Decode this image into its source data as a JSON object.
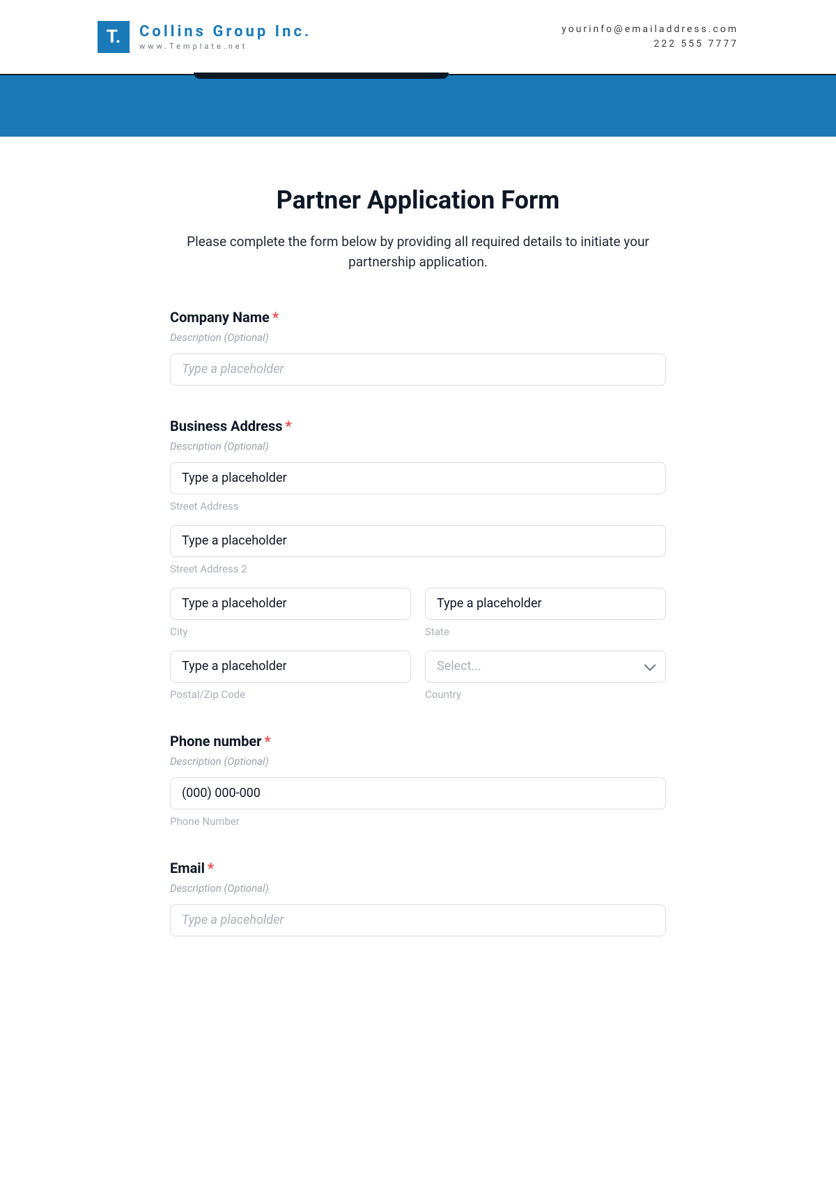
{
  "header": {
    "logo_text": "T.",
    "brand_name": "Collins Group Inc.",
    "brand_site": "www.Template.net",
    "contact_email": "yourinfo@emailaddress.com",
    "contact_phone": "222 555 7777"
  },
  "form": {
    "title": "Partner Application Form",
    "intro": "Please complete the form below by providing all required details to initiate your partnership application.",
    "description_label": "Description (Optional)",
    "generic_placeholder": "Type a placeholder",
    "required_marker": "*",
    "fields": {
      "company_name": {
        "label": "Company Name"
      },
      "business_address": {
        "label": "Business Address",
        "street": {
          "sublabel": "Street Address",
          "value": "Type a placeholder"
        },
        "street2": {
          "sublabel": "Street Address 2",
          "value": "Type a placeholder"
        },
        "city": {
          "sublabel": "City",
          "value": "Type a placeholder"
        },
        "state": {
          "sublabel": "State",
          "value": "Type a placeholder"
        },
        "postal": {
          "sublabel": "Postal/Zip Code",
          "value": "Type a placeholder"
        },
        "country": {
          "sublabel": "Country",
          "placeholder": "Select..."
        }
      },
      "phone": {
        "label": "Phone number",
        "sublabel": "Phone Number",
        "value": "(000) 000-000"
      },
      "email": {
        "label": "Email"
      }
    }
  }
}
